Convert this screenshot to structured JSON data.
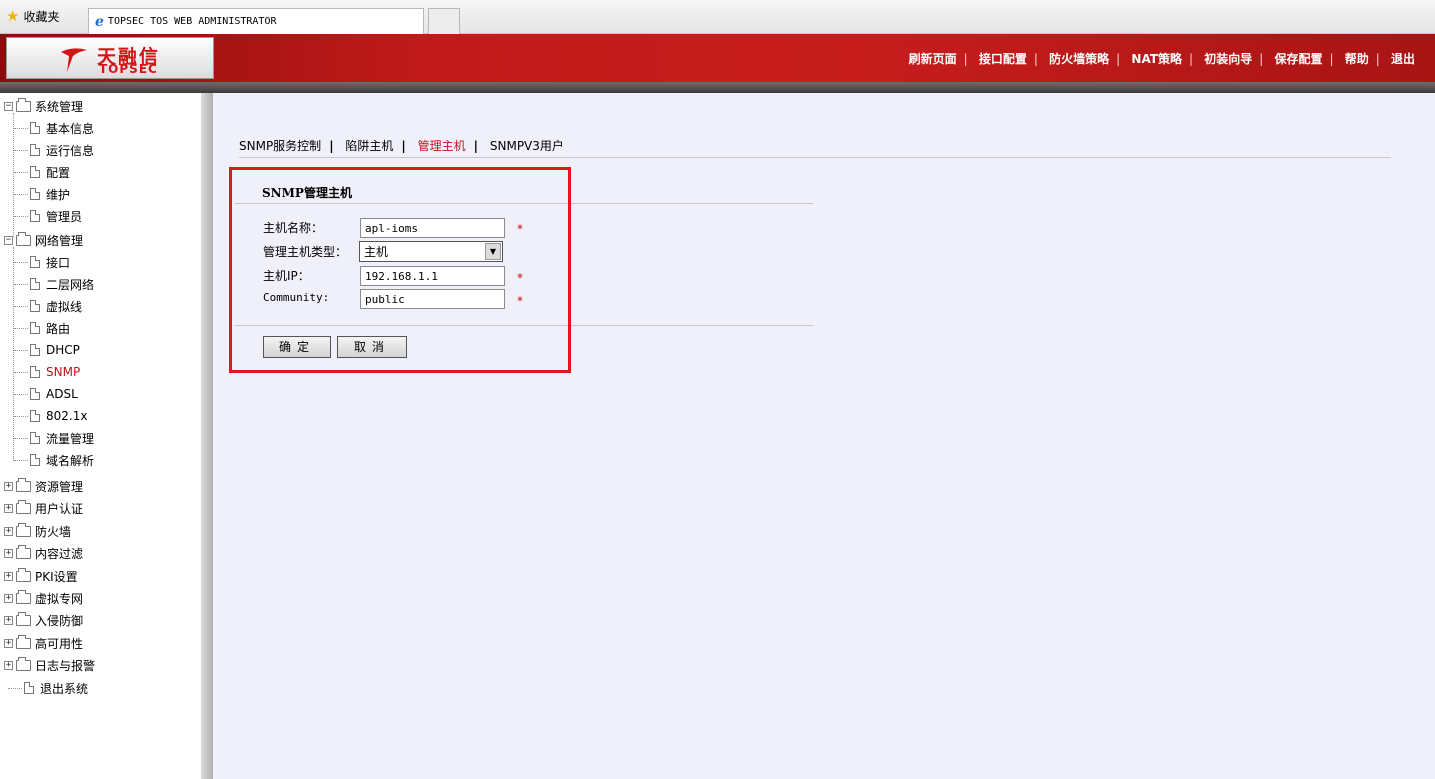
{
  "browser": {
    "favorites_label": "收藏夹",
    "tab_title": "TOPSEC TOS WEB ADMINISTRATOR"
  },
  "header": {
    "logo_cn": "天融信",
    "logo_en": "TOPSEC",
    "nav": [
      "刷新页面",
      "接口配置",
      "防火墙策略",
      "NAT策略",
      "初装向导",
      "保存配置",
      "帮助",
      "退出"
    ]
  },
  "sidebar": {
    "groups": [
      {
        "label": "系统管理",
        "expanded": true,
        "children": [
          "基本信息",
          "运行信息",
          "配置",
          "维护",
          "管理员"
        ]
      },
      {
        "label": "网络管理",
        "expanded": true,
        "children": [
          "接口",
          "二层网络",
          "虚拟线",
          "路由",
          "DHCP",
          "SNMP",
          "ADSL",
          "802.1x",
          "流量管理",
          "域名解析"
        ]
      },
      {
        "label": "资源管理",
        "expanded": false
      },
      {
        "label": "用户认证",
        "expanded": false
      },
      {
        "label": "防火墙",
        "expanded": false
      },
      {
        "label": "内容过滤",
        "expanded": false
      },
      {
        "label": "PKI设置",
        "expanded": false
      },
      {
        "label": "虚拟专网",
        "expanded": false
      },
      {
        "label": "入侵防御",
        "expanded": false
      },
      {
        "label": "高可用性",
        "expanded": false
      },
      {
        "label": "日志与报警",
        "expanded": false
      }
    ],
    "logout": "退出系统",
    "active": "SNMP"
  },
  "main": {
    "subnav": [
      "SNMP服务控制",
      "陷阱主机",
      "管理主机",
      "SNMPV3用户"
    ],
    "subnav_active": "管理主机",
    "section_title": "SNMP管理主机",
    "form": {
      "hostname_label": "主机名称：",
      "hostname_value": "apl-ioms",
      "type_label": "管理主机类型：",
      "type_value": "主机",
      "ip_label": "主机IP：",
      "ip_value": "192.168.1.1",
      "community_label": "Community:",
      "community_value": "public",
      "required_mark": "*"
    },
    "buttons": {
      "ok": "确定",
      "cancel": "取消"
    }
  },
  "colors": {
    "header_red": "#c21a1a",
    "active_red": "#c0141a",
    "highlight_box": "#e2141c",
    "main_bg": "#f0f0fa"
  }
}
